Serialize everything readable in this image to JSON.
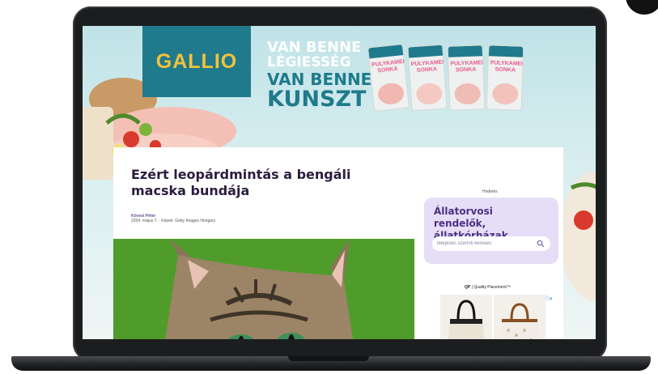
{
  "ad_banner": {
    "brand": "GALLIO",
    "slogan_lines": [
      "VAN BENNE",
      "LÉGIESSÉG",
      "VAN BENNE",
      "KUNSZT"
    ],
    "product_label": [
      "PULYKAMELL-",
      "SONKA"
    ],
    "colors": {
      "teal": "#1f7a8c",
      "yellow": "#f3c23a",
      "pink": "#e85a8f"
    }
  },
  "article": {
    "title": "Ezért leopárdmintás a bengáli macska bundája",
    "author": "Kövesi Péter",
    "dateline": "2024. május 7. · Képek: Getty Images Hungary"
  },
  "sidebar": {
    "ad_label": "Hirdetés",
    "vet_widget": {
      "title": "Állatorvosi rendelők, állatkórházak",
      "search_placeholder": "település szerinti keresés",
      "accent": "#4a2f84",
      "background": "#e6def7"
    },
    "qp_ad": {
      "logo": "QP",
      "label": "Quality Placement™",
      "adchoices": "ⓘ✕"
    }
  }
}
